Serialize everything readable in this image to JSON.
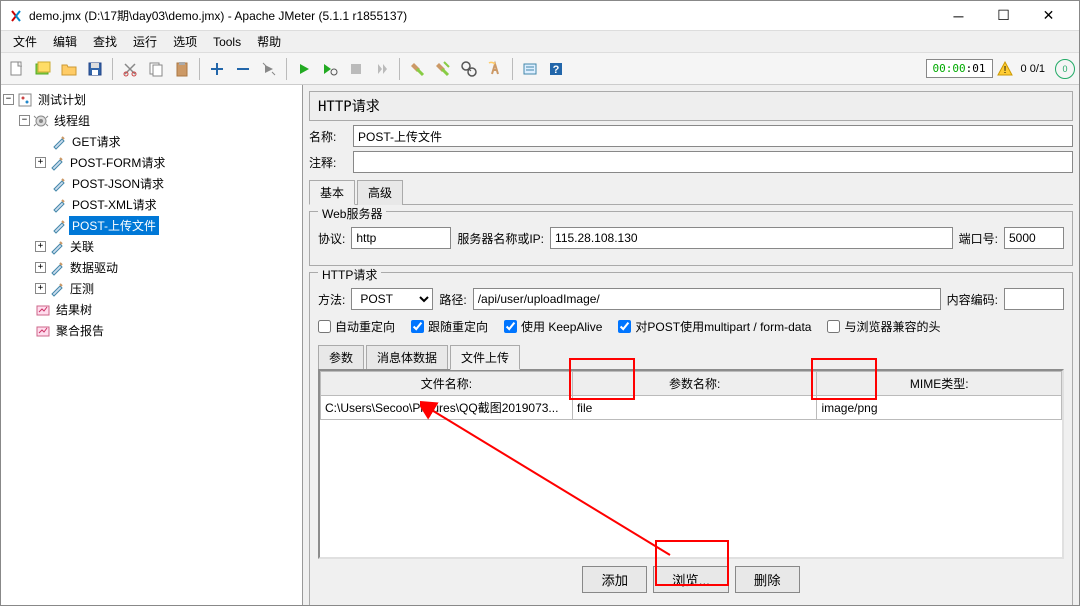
{
  "window": {
    "title": "demo.jmx (D:\\17期\\day03\\demo.jmx) - Apache JMeter (5.1.1 r1855137)"
  },
  "menu": {
    "file": "文件",
    "edit": "编辑",
    "search": "查找",
    "run": "运行",
    "options": "选项",
    "tools": "Tools",
    "help": "帮助"
  },
  "toolbar": {
    "timer": "00:00:01",
    "count": "0  0/1"
  },
  "tree": {
    "root": "测试计划",
    "group": "线程组",
    "items": [
      "GET请求",
      "POST-FORM请求",
      "POST-JSON请求",
      "POST-XML请求",
      "POST-上传文件",
      "关联",
      "数据驱动",
      "压测"
    ],
    "result": "结果树",
    "report": "聚合报告"
  },
  "editor": {
    "panelTitle": "HTTP请求",
    "nameLabel": "名称:",
    "nameValue": "POST-上传文件",
    "commentLabel": "注释:",
    "commentValue": "",
    "tabBasic": "基本",
    "tabAdv": "高级",
    "webServer": "Web服务器",
    "protoLabel": "协议:",
    "protoValue": "http",
    "serverLabel": "服务器名称或IP:",
    "serverValue": "115.28.108.130",
    "portLabel": "端口号:",
    "portValue": "5000",
    "httpReq": "HTTP请求",
    "methodLabel": "方法:",
    "methodValue": "POST",
    "pathLabel": "路径:",
    "pathValue": "/api/user/uploadImage/",
    "encLabel": "内容编码:",
    "encValue": "",
    "c1": "自动重定向",
    "c2": "跟随重定向",
    "c3": "使用 KeepAlive",
    "c4": "对POST使用multipart / form-data",
    "c5": "与浏览器兼容的头",
    "st1": "参数",
    "st2": "消息体数据",
    "st3": "文件上传",
    "th1": "文件名称:",
    "th2": "参数名称:",
    "th3": "MIME类型:",
    "td1": "C:\\Users\\Secoo\\Pictures\\QQ截图2019073...",
    "td2": "file",
    "td3": "image/png",
    "btnAdd": "添加",
    "btnBrowse": "浏览...",
    "btnDel": "删除"
  }
}
